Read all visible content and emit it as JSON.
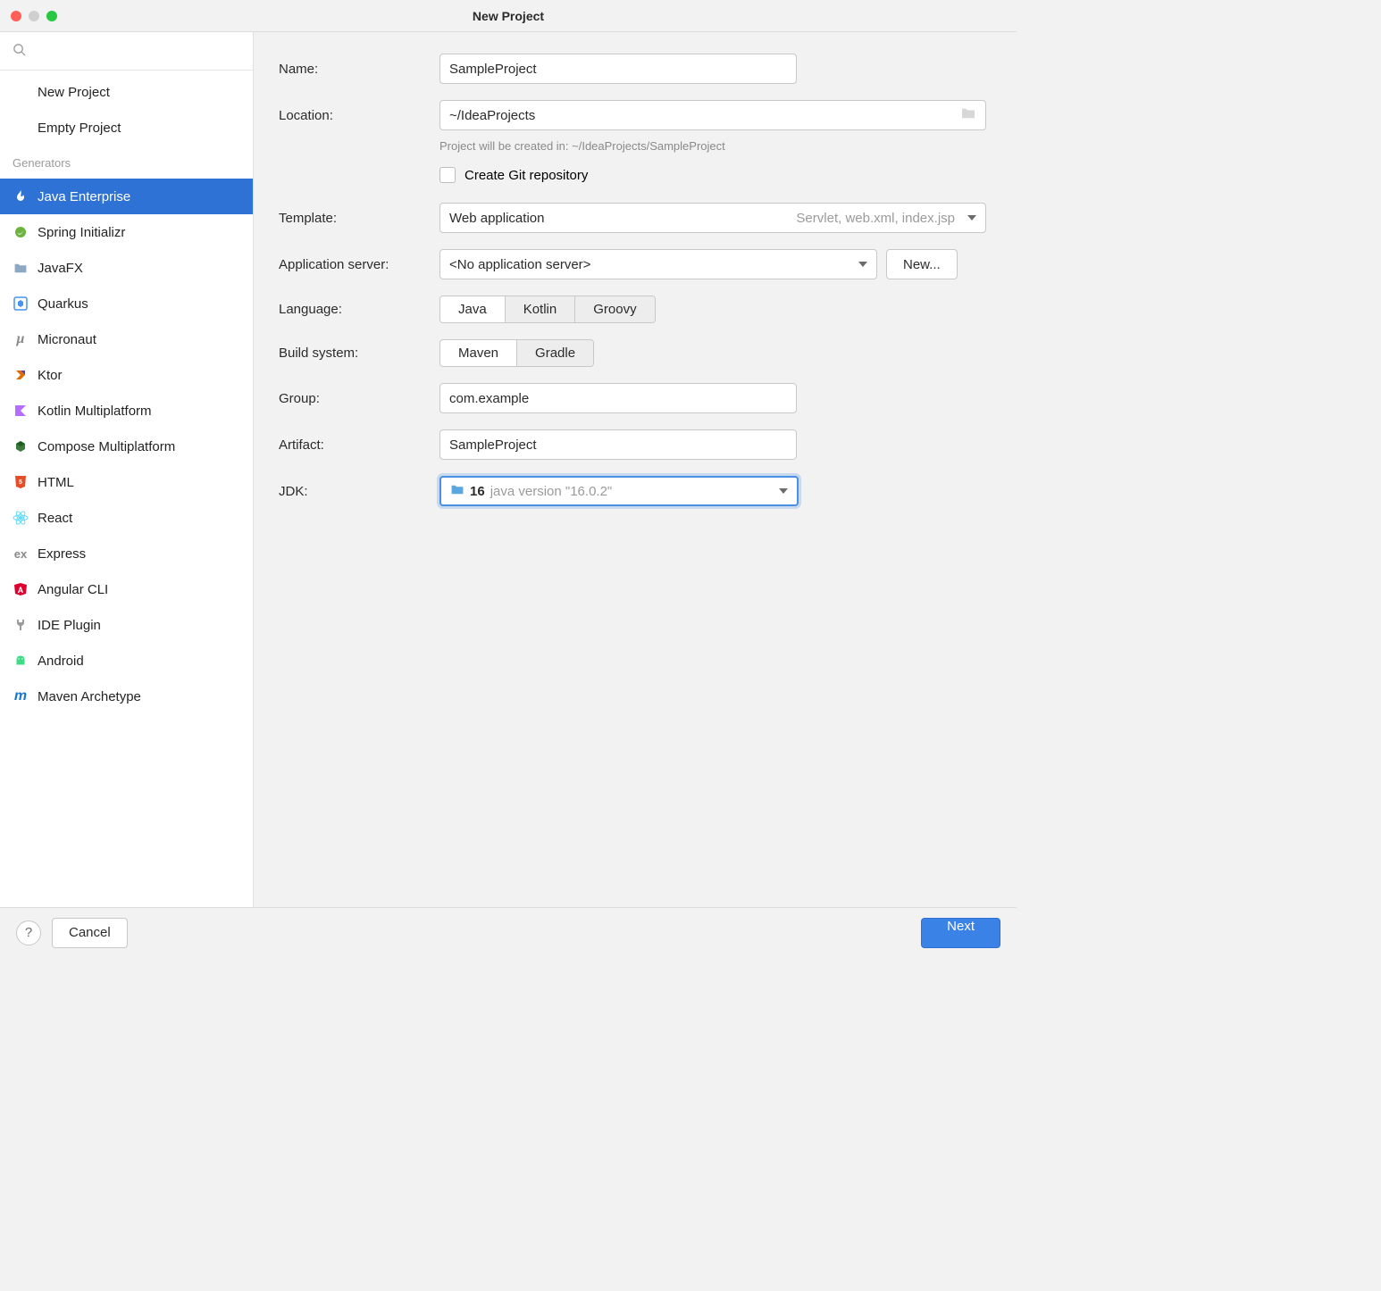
{
  "window": {
    "title": "New Project"
  },
  "sidebar": {
    "top": [
      {
        "label": "New Project"
      },
      {
        "label": "Empty Project"
      }
    ],
    "generators_label": "Generators",
    "generators": [
      {
        "label": "Java Enterprise",
        "icon": "flame",
        "color": "#f58e27",
        "selected": true
      },
      {
        "label": "Spring Initializr",
        "icon": "spring",
        "color": "#6db33f"
      },
      {
        "label": "JavaFX",
        "icon": "folder",
        "color": "#8da8c5"
      },
      {
        "label": "Quarkus",
        "icon": "quarkus",
        "color": "#4695eb"
      },
      {
        "label": "Micronaut",
        "icon": "mu",
        "color": "#888"
      },
      {
        "label": "Ktor",
        "icon": "ktor",
        "color": "#e06c00"
      },
      {
        "label": "Kotlin Multiplatform",
        "icon": "kotlin",
        "color": "#b66cff"
      },
      {
        "label": "Compose Multiplatform",
        "icon": "compose",
        "color": "#3e7a3e"
      },
      {
        "label": "HTML",
        "icon": "html5",
        "color": "#e44d26"
      },
      {
        "label": "React",
        "icon": "react",
        "color": "#61dafb"
      },
      {
        "label": "Express",
        "icon": "ex",
        "color": "#888"
      },
      {
        "label": "Angular CLI",
        "icon": "angular",
        "color": "#dd0031"
      },
      {
        "label": "IDE Plugin",
        "icon": "plug",
        "color": "#9c9c9c"
      },
      {
        "label": "Android",
        "icon": "android",
        "color": "#3ddc84"
      },
      {
        "label": "Maven Archetype",
        "icon": "m",
        "color": "#1878d1"
      }
    ]
  },
  "form": {
    "name_label": "Name:",
    "name_value": "SampleProject",
    "location_label": "Location:",
    "location_value": "~/IdeaProjects",
    "location_hint": "Project will be created in: ~/IdeaProjects/SampleProject",
    "git_label": "Create Git repository",
    "template_label": "Template:",
    "template_value": "Web application",
    "template_hint": "Servlet, web.xml, index.jsp",
    "appserver_label": "Application server:",
    "appserver_value": "<No application server>",
    "appserver_new": "New...",
    "language_label": "Language:",
    "language_options": [
      "Java",
      "Kotlin",
      "Groovy"
    ],
    "build_label": "Build system:",
    "build_options": [
      "Maven",
      "Gradle"
    ],
    "group_label": "Group:",
    "group_value": "com.example",
    "artifact_label": "Artifact:",
    "artifact_value": "SampleProject",
    "jdk_label": "JDK:",
    "jdk_value": "16",
    "jdk_hint": "java version \"16.0.2\""
  },
  "footer": {
    "cancel": "Cancel",
    "next": "Next"
  }
}
